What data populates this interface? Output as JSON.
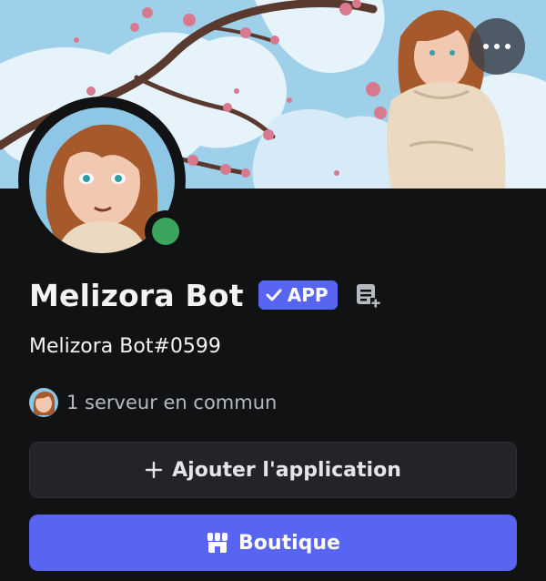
{
  "banner": {
    "image": "anime-girl-cherry-blossom-banner",
    "more_icon": "more-horizontal-icon"
  },
  "profile": {
    "display_name": "Melizora Bot",
    "badge_label": "APP",
    "badge_icon": "checkmark-icon",
    "note_icon": "note-add-icon",
    "username_tag": "Melizora Bot#0599",
    "status": "online",
    "status_color": "#3ba55d"
  },
  "mutual": {
    "label": "1 serveur en commun",
    "avatar": "server-avatar"
  },
  "buttons": {
    "add_label": "Ajouter l'application",
    "add_icon": "plus-icon",
    "shop_label": "Boutique",
    "shop_icon": "store-icon"
  },
  "colors": {
    "accent": "#5865f2",
    "background": "#111214",
    "button_secondary": "#232428"
  }
}
